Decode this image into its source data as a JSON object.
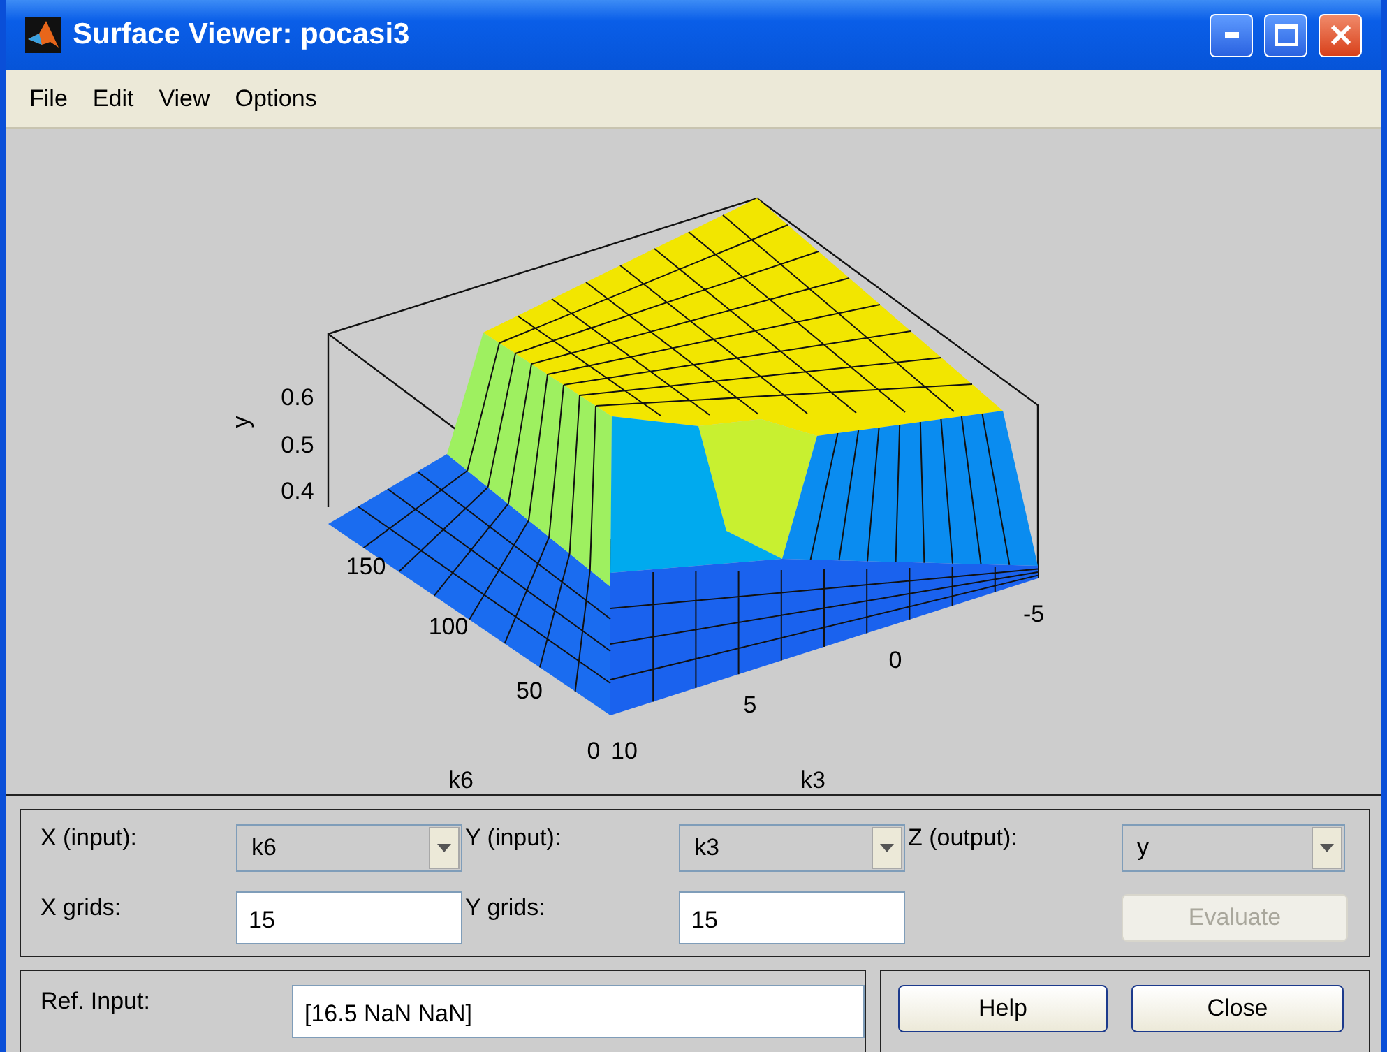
{
  "window": {
    "title": "Surface Viewer: pocasi3"
  },
  "menu": [
    "File",
    "Edit",
    "View",
    "Options"
  ],
  "plot": {
    "zlabel": "y",
    "xlabel": "k6",
    "ylabel": "k3",
    "z_ticks": [
      "0.6",
      "0.5",
      "0.4"
    ],
    "x_ticks": [
      "150",
      "100",
      "50",
      "0"
    ],
    "y_ticks": [
      "10",
      "5",
      "0",
      "-5"
    ]
  },
  "axes": [
    {
      "label": "X (input):",
      "value": "k6",
      "grid_label": "X grids:",
      "grids": "15"
    },
    {
      "label": "Y (input):",
      "value": "k3",
      "grid_label": "Y grids:",
      "grids": "15"
    },
    {
      "label": "Z (output):",
      "value": "y"
    }
  ],
  "evaluate": {
    "label": "Evaluate",
    "disabled": true
  },
  "ref_input": {
    "label": "Ref. Input:",
    "value": "[16.5 NaN NaN]"
  },
  "buttons": [
    "Help",
    "Close"
  ]
}
